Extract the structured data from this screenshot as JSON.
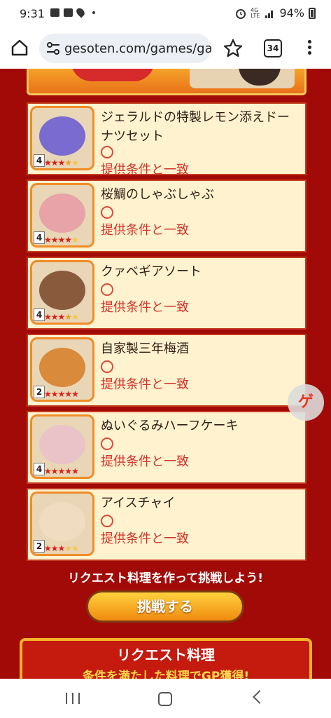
{
  "status": {
    "time": "9:31",
    "network": "4G",
    "network_sub": "LTE",
    "battery": "94%"
  },
  "browser": {
    "url": "gesoten.com/games/gar",
    "tab_count": "34",
    "icons": [
      "home-icon",
      "site-settings-icon",
      "bookmark-star-icon",
      "tabs-icon",
      "menu-icon"
    ]
  },
  "items": [
    {
      "name": "ジェラルドの特製レモン添えドーナツセット",
      "level": "4",
      "stars": 3.5,
      "circle": "○",
      "match": "提供条件と一致",
      "color": "#7a6bd0"
    },
    {
      "name": "桜鯛のしゃぶしゃぶ",
      "level": "4",
      "stars": 4,
      "circle": "○",
      "match": "提供条件と一致",
      "color": "#e7a3a8"
    },
    {
      "name": "クァベギアソート",
      "level": "4",
      "stars": 3.5,
      "circle": "○",
      "match": "提供条件と一致",
      "color": "#8a5a3c"
    },
    {
      "name": "自家製三年梅酒",
      "level": "2",
      "stars": 5,
      "circle": "○",
      "match": "提供条件と一致",
      "color": "#d98a3a"
    },
    {
      "name": "ぬいぐるみハーフケーキ",
      "level": "4",
      "stars": 5,
      "circle": "○",
      "match": "提供条件と一致",
      "color": "#e9c3c8"
    },
    {
      "name": "アイスチャイ",
      "level": "2",
      "stars": 3,
      "circle": "○",
      "match": "提供条件と一致",
      "color": "#f0dcc0"
    }
  ],
  "request_prompt": "リクエスト料理を作って挑戦しよう!",
  "challenge_button": "挑戦する",
  "request_panel": {
    "title": "リクエスト料理",
    "subtitle": "条件を満たした料理でGP獲得!"
  },
  "float_button_glyph": "ゲ"
}
